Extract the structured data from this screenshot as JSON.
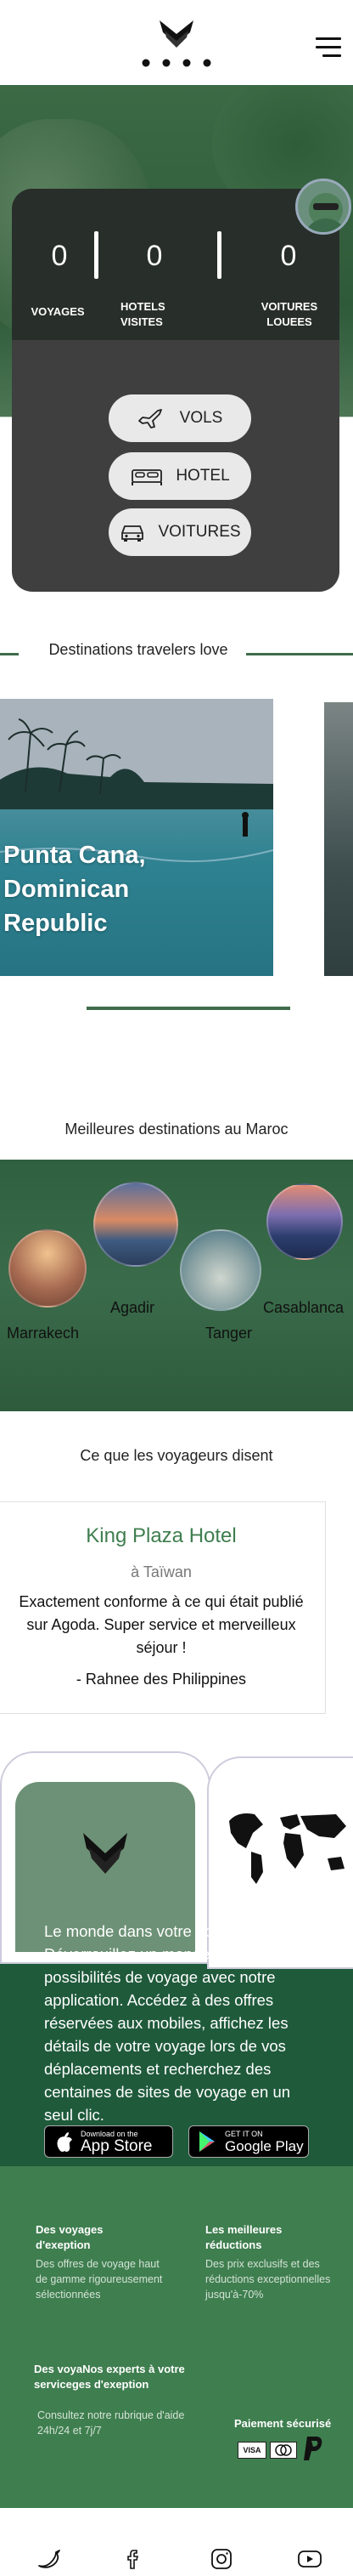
{
  "hero": {
    "stats": [
      {
        "value": "0",
        "label_line1": "VOYAGES",
        "label_line2": ""
      },
      {
        "value": "0",
        "label_line1": "HOTELS",
        "label_line2": "VISITES"
      },
      {
        "value": "0",
        "label_line1": "VOITURES",
        "label_line2": "LOUEES"
      }
    ],
    "buttons": [
      "VOLS",
      "HOTEL",
      "VOITURES"
    ]
  },
  "destinations": {
    "title": "Destinations travelers love",
    "card_title_lines": [
      "Punta Cana,",
      "Dominican",
      "Republic"
    ]
  },
  "maroc": {
    "title": "Meilleures destinations au Maroc",
    "cities": [
      "Marrakech",
      "Agadir",
      "Tanger",
      "Casablanca"
    ]
  },
  "reviews": {
    "title": "Ce que les voyageurs disent",
    "hotel": "King Plaza Hotel",
    "location": "à Taïwan",
    "quote": "Exactement conforme à ce qui était publié sur Agoda. Super service et merveilleux séjour !",
    "author": "- Rahnee des Philippines"
  },
  "app": {
    "text": "Le monde dans votre poche Déverrouillez un monde de possibilités de voyage avec notre application. Accédez à des offres réservées aux mobiles, affichez les détails de votre voyage lors de vos déplacements et recherchez des centaines de sites de voyage en un seul clic.",
    "appstore_small": "Download on the",
    "appstore_big": "App Store",
    "play_small": "GET IT ON",
    "play_big": "Google Play"
  },
  "footer": {
    "col1_title": "Des voyages d'exeption",
    "col1_text": "Des offres de voyage haut de gamme rigoureusement sélectionnées",
    "col2_title": "Les meilleures réductions",
    "col2_text": "Des prix exclusifs et des réductions exceptionnelles jusqu'à-70%",
    "col3_title": "Des voyaNos experts à votre serviceges d'exeption",
    "col3_text": "Consultez notre rubrique d'aide 24h/24 et 7j/7",
    "payment_title": "Paiement sécurisé",
    "payment_cards": [
      "VISA",
      "MC"
    ]
  },
  "icons": [
    "twitter-icon",
    "facebook-icon",
    "instagram-icon",
    "youtube-icon"
  ],
  "colors": {
    "brand_green": "#3f7e4f",
    "dark_green": "#1f5a3b"
  }
}
